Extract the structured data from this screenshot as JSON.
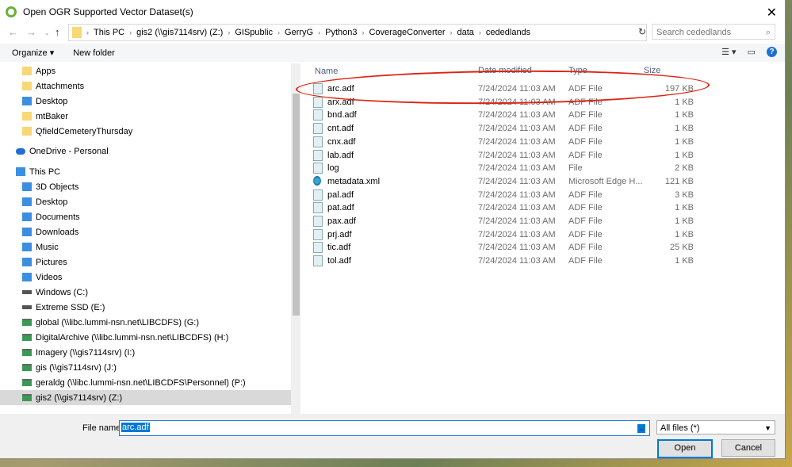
{
  "title": "Open OGR Supported Vector Dataset(s)",
  "breadcrumb": [
    "This PC",
    "gis2 (\\\\gis7114srv) (Z:)",
    "GISpublic",
    "GerryG",
    "Python3",
    "CoverageConverter",
    "data",
    "cededlands"
  ],
  "search_placeholder": "Search cededlands",
  "toolbar": {
    "organize": "Organize ▾",
    "new_folder": "New folder"
  },
  "nav": [
    {
      "label": "Apps",
      "icon": "folder-icon"
    },
    {
      "label": "Attachments",
      "icon": "folder-icon"
    },
    {
      "label": "Desktop",
      "icon": "desktop-icon"
    },
    {
      "label": "mtBaker",
      "icon": "folder-icon"
    },
    {
      "label": "QfieldCemeteryThursday",
      "icon": "folder-icon"
    },
    {
      "label": "OneDrive - Personal",
      "icon": "cloud-icon"
    },
    {
      "label": "This PC",
      "icon": "computer-icon"
    },
    {
      "label": "3D Objects",
      "icon": "cube-icon"
    },
    {
      "label": "Desktop",
      "icon": "desktop-icon"
    },
    {
      "label": "Documents",
      "icon": "documents-icon"
    },
    {
      "label": "Downloads",
      "icon": "download-icon"
    },
    {
      "label": "Music",
      "icon": "music-icon"
    },
    {
      "label": "Pictures",
      "icon": "pictures-icon"
    },
    {
      "label": "Videos",
      "icon": "videos-icon"
    },
    {
      "label": "Windows (C:)",
      "icon": "drive-icon"
    },
    {
      "label": "Extreme SSD (E:)",
      "icon": "drive-icon"
    },
    {
      "label": "global (\\\\libc.lummi-nsn.net\\LIBCDFS) (G:)",
      "icon": "network-drive-icon"
    },
    {
      "label": "DigitalArchive (\\\\libc.lummi-nsn.net\\LIBCDFS) (H:)",
      "icon": "network-drive-icon"
    },
    {
      "label": "Imagery (\\\\gis7114srv) (I:)",
      "icon": "network-drive-icon"
    },
    {
      "label": "gis (\\\\gis7114srv) (J:)",
      "icon": "network-drive-icon"
    },
    {
      "label": "geraldg (\\\\libc.lummi-nsn.net\\LIBCDFS\\Personnel) (P:)",
      "icon": "network-drive-icon"
    },
    {
      "label": "gis2 (\\\\gis7114srv) (Z:)",
      "icon": "network-drive-icon",
      "selected": true
    }
  ],
  "columns": [
    "Name",
    "Date modified",
    "Type",
    "Size"
  ],
  "files": [
    [
      "arc.adf",
      "7/24/2024 11:03 AM",
      "ADF File",
      "197 KB"
    ],
    [
      "arx.adf",
      "7/24/2024 11:03 AM",
      "ADF File",
      "1 KB"
    ],
    [
      "bnd.adf",
      "7/24/2024 11:03 AM",
      "ADF File",
      "1 KB"
    ],
    [
      "cnt.adf",
      "7/24/2024 11:03 AM",
      "ADF File",
      "1 KB"
    ],
    [
      "cnx.adf",
      "7/24/2024 11:03 AM",
      "ADF File",
      "1 KB"
    ],
    [
      "lab.adf",
      "7/24/2024 11:03 AM",
      "ADF File",
      "1 KB"
    ],
    [
      "log",
      "7/24/2024 11:03 AM",
      "File",
      "2 KB"
    ],
    [
      "metadata.xml",
      "7/24/2024 11:03 AM",
      "Microsoft Edge H...",
      "121 KB"
    ],
    [
      "pal.adf",
      "7/24/2024 11:03 AM",
      "ADF File",
      "3 KB"
    ],
    [
      "pat.adf",
      "7/24/2024 11:03 AM",
      "ADF File",
      "1 KB"
    ],
    [
      "pax.adf",
      "7/24/2024 11:03 AM",
      "ADF File",
      "1 KB"
    ],
    [
      "prj.adf",
      "7/24/2024 11:03 AM",
      "ADF File",
      "1 KB"
    ],
    [
      "tic.adf",
      "7/24/2024 11:03 AM",
      "ADF File",
      "25 KB"
    ],
    [
      "tol.adf",
      "7/24/2024 11:03 AM",
      "ADF File",
      "1 KB"
    ]
  ],
  "file_name_label": "File name:",
  "file_name": "arc.adf",
  "filter": "All files (*)",
  "open": "Open",
  "cancel": "Cancel"
}
